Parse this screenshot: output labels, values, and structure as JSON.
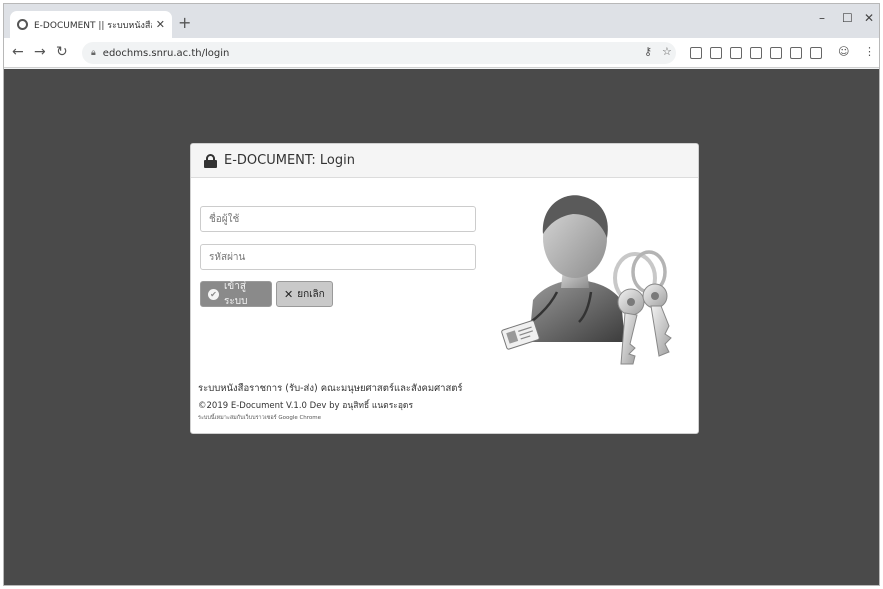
{
  "browser": {
    "tab_title": "E-DOCUMENT || ระบบหนังสือราชการ",
    "new_tab_symbol": "+",
    "url": "edochms.snru.ac.th/login",
    "window_controls": {
      "minimize": "–",
      "maximize": "☐",
      "close": "✕"
    }
  },
  "login": {
    "title": "E-DOCUMENT: Login",
    "username_placeholder": "ชื่อผู้ใช้",
    "password_placeholder": "รหัสผ่าน",
    "login_button": "เข้าสู่ระบบ",
    "cancel_button": "ยกเลิก"
  },
  "footer": {
    "system_name": "ระบบหนังสือราชการ (รับ-ส่ง) คณะมนุษยศาสตร์และสังคมศาสตร์",
    "copyright": "©2019 E-Document V.1.0 Dev by อนุสิทธิ์ แนตระอุดร",
    "browser_note": "ระบบนี้เหมาะสมกับเว็บบราวเซอร์ Google Chrome"
  },
  "icons": {
    "lock": "lock-icon",
    "user_keys": "user-with-keys-illustration",
    "check": "check-circle-icon",
    "times": "times-icon"
  },
  "colors": {
    "page_background": "#4a4a4a",
    "login_button": "#8a8a8a",
    "cancel_button": "#c9c9c9"
  }
}
